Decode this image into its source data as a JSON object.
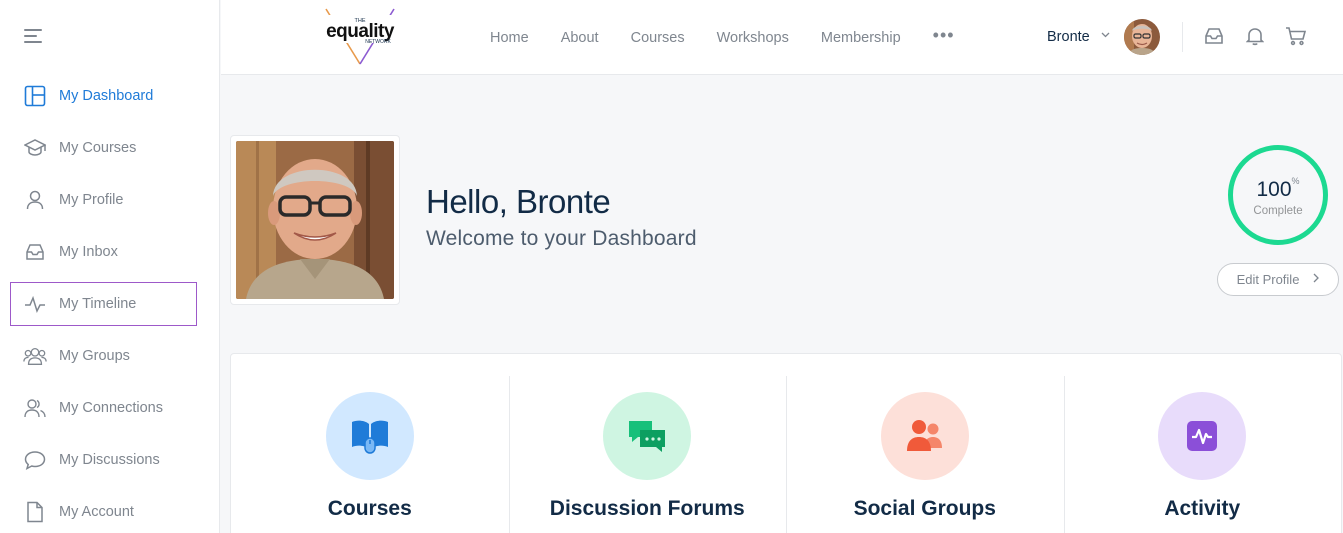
{
  "sidebar": {
    "items": [
      {
        "label": "My Dashboard"
      },
      {
        "label": "My Courses"
      },
      {
        "label": "My Profile"
      },
      {
        "label": "My Inbox"
      },
      {
        "label": "My Timeline"
      },
      {
        "label": "My Groups"
      },
      {
        "label": "My Connections"
      },
      {
        "label": "My Discussions"
      },
      {
        "label": "My Account"
      }
    ],
    "active_color": "#1f7bd8",
    "focus_color": "#9d59c9"
  },
  "header": {
    "logo": {
      "line1": "THE",
      "word": "equality",
      "line3": "NETWORK"
    },
    "nav": [
      "Home",
      "About",
      "Courses",
      "Workshops",
      "Membership"
    ],
    "more": "•••",
    "user_name": "Bronte",
    "icons": [
      "inbox-icon",
      "bell-icon",
      "cart-icon"
    ]
  },
  "main": {
    "greeting_prefix": "Hello,",
    "greeting_name": "Bronte",
    "welcome": "Welcome to your Dashboard",
    "completion": {
      "value": "100",
      "unit": "%",
      "label": "Complete",
      "color": "#1cd991"
    },
    "edit_profile": "Edit Profile"
  },
  "cards": [
    {
      "title": "Courses",
      "icon": "book-icon",
      "bg": "#d1e8ff"
    },
    {
      "title": "Discussion Forums",
      "icon": "chat-icon",
      "bg": "#cff5e2"
    },
    {
      "title": "Social Groups",
      "icon": "group-icon",
      "bg": "#fde0d9"
    },
    {
      "title": "Activity",
      "icon": "activity-icon",
      "bg": "#e8dcfb"
    }
  ]
}
